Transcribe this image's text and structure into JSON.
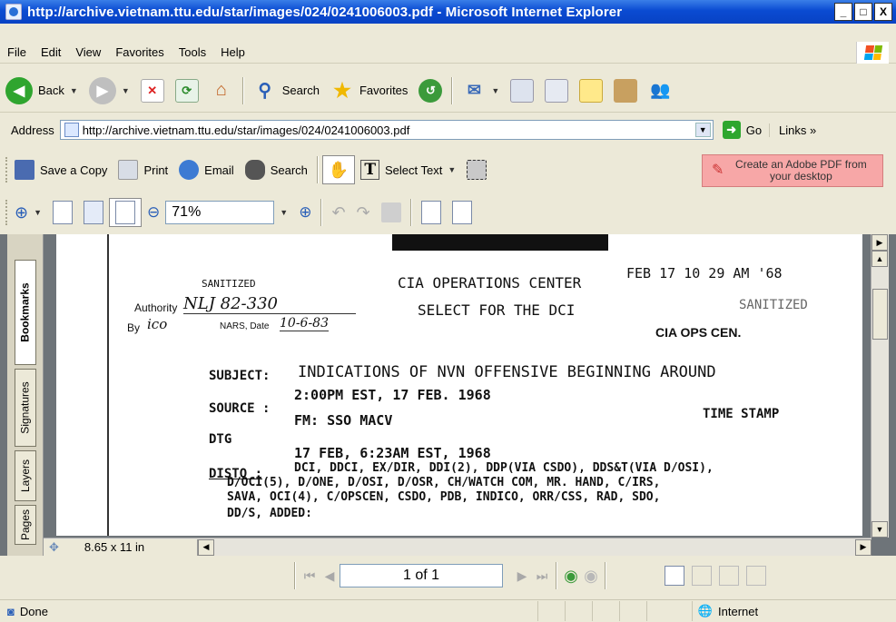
{
  "window": {
    "title": "http://archive.vietnam.ttu.edu/star/images/024/0241006003.pdf - Microsoft Internet Explorer",
    "minimize": "_",
    "maximize": "□",
    "close": "X"
  },
  "menu": [
    "File",
    "Edit",
    "View",
    "Favorites",
    "Tools",
    "Help"
  ],
  "toolbar": {
    "back": "Back",
    "search": "Search",
    "favorites": "Favorites"
  },
  "address": {
    "label": "Address",
    "value": "http://archive.vietnam.ttu.edu/star/images/024/0241006003.pdf",
    "go": "Go",
    "links": "Links »"
  },
  "acrobat": {
    "save_copy": "Save a Copy",
    "print": "Print",
    "email": "Email",
    "search": "Search",
    "select_text": "Select Text",
    "create_pdf": "Create an Adobe PDF from your desktop",
    "zoom": "71%",
    "page_size": "8.65 x 11 in",
    "page_indicator": "1 of 1"
  },
  "sidebar_tabs": [
    "Bookmarks",
    "Signatures",
    "Layers",
    "Pages"
  ],
  "document": {
    "sanitized_top": "SANITIZED",
    "authority_label": "Authority",
    "authority_value": "NLJ 82-330",
    "by_label": "By",
    "by_value": "ico",
    "nars_date_label": "NARS, Date",
    "nars_date_value": "10-6-83",
    "header1": "CIA OPERATIONS CENTER",
    "header2": "SELECT FOR THE DCI",
    "timestamp_stamp": "FEB 17  10 29 AM '68",
    "sanitized_right": "SANITIZED",
    "ops_cen": "CIA OPS CEN.",
    "subject_label": "SUBJECT:",
    "subject_line1": "INDICATIONS OF NVN OFFENSIVE BEGINNING AROUND",
    "subject_line2": "2:00PM EST, 17 FEB. 1968",
    "source_label": "SOURCE :",
    "source_value": "FM: SSO MACV",
    "time_stamp": "TIME STAMP",
    "dtg_label": "DTG",
    "dtg_value": "17 FEB, 6:23AM EST, 1968",
    "disto_label": "DISTO :",
    "disto_line1": "DCI, DDCI, EX/DIR, DDI(2), DDP(VIA CSDO), DDS&T(VIA D/OSI),",
    "disto_line2": "D/OCI(5), D/ONE, D/OSI, D/OSR, CH/WATCH COM, MR. HAND, C/IRS,",
    "disto_line3": "SAVA, OCI(4), C/OPSCEN, CSDO, PDB, INDICO, ORR/CSS, RAD, SDO,",
    "disto_line4": "DD/S,  ADDED:"
  },
  "status": {
    "done": "Done",
    "zone": "Internet"
  }
}
